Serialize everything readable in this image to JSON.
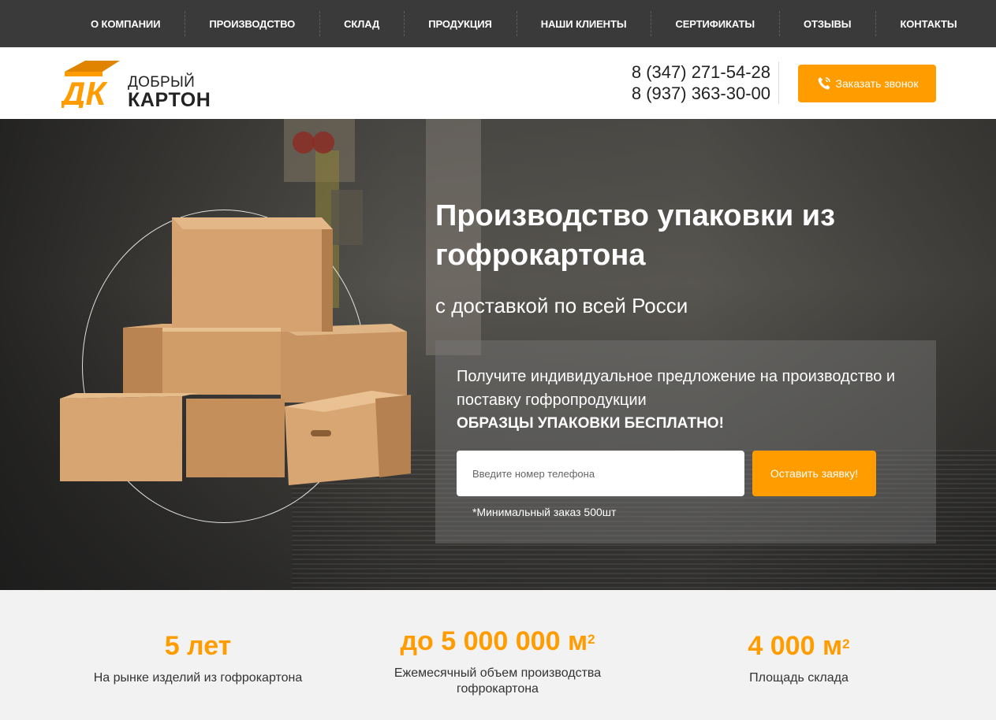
{
  "nav": {
    "items": [
      {
        "label": "О КОМПАНИИ"
      },
      {
        "label": "ПРОИЗВОДСТВО"
      },
      {
        "label": "СКЛАД"
      },
      {
        "label": "ПРОДУКЦИЯ"
      },
      {
        "label": "НАШИ КЛИЕНТЫ"
      },
      {
        "label": "СЕРТИФИКАТЫ"
      },
      {
        "label": "ОТЗЫВЫ"
      },
      {
        "label": "КОНТАКТЫ"
      }
    ]
  },
  "header": {
    "logo": {
      "mark": "ДК",
      "line1": "ДОБРЫЙ",
      "line2": "КАРТОН"
    },
    "phones": [
      "8 (347) 271-54-28",
      "8 (937) 363-30-00"
    ],
    "call_button": {
      "label": "Заказать звонок",
      "icon": "phone-icon"
    }
  },
  "hero": {
    "title": "Производство упаковки из гофрокартона",
    "subtitle": "с доставкой по всей Росси",
    "offer": {
      "text": "Получите индивидуальное предложение на производство и поставку гофропродукции",
      "highlight": "ОБРАЗЦЫ УПАКОВКИ БЕСПЛАТНО!",
      "phone_placeholder": "Введите номер телефона",
      "submit_label": "Оставить заявку!",
      "note": "*Минимальный заказ 500шт"
    }
  },
  "stats": [
    {
      "value": "5 лет",
      "sup": "",
      "label": "На рынке изделий из гофрокартона"
    },
    {
      "value": "до 5 000 000 м",
      "sup": "2",
      "label": "Ежемесячный объем производства гофрокартона"
    },
    {
      "value": "4 000 м",
      "sup": "2",
      "label": "Площадь склада"
    }
  ],
  "colors": {
    "accent": "#ff9c00",
    "nav_bg": "#3a3a3a",
    "stats_bg": "#f2f2f2"
  }
}
